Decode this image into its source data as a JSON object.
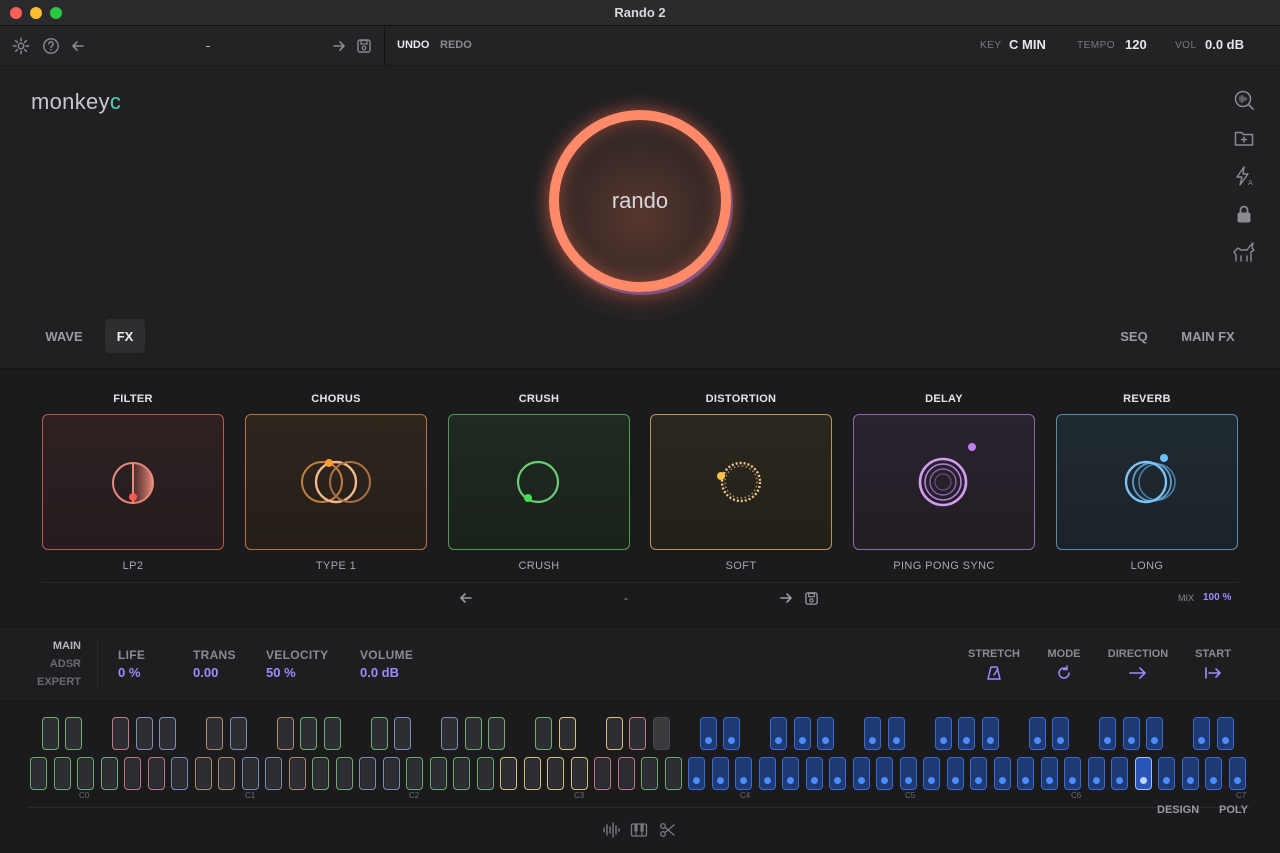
{
  "window": {
    "title": "Rando 2"
  },
  "toolbar": {
    "preset_name": "-",
    "undo_label": "UNDO",
    "redo_label": "REDO",
    "key_label": "KEY",
    "key_value": "C MIN",
    "tempo_label": "TEMPO",
    "tempo_value": "120",
    "vol_label": "VOL",
    "vol_value": "0.0 dB"
  },
  "logo": {
    "text_main": "monkey",
    "text_accent": "c"
  },
  "center_ring": {
    "label": "rando",
    "color": "#ff8a6a"
  },
  "sidebar_icons": [
    "search-sound-icon",
    "add-folder-icon",
    "auto-flash-icon",
    "lock-icon",
    "unicorn-icon"
  ],
  "tabs": {
    "left": [
      {
        "label": "WAVE",
        "active": false
      },
      {
        "label": "FX",
        "active": true
      }
    ],
    "right": [
      {
        "label": "SEQ"
      },
      {
        "label": "MAIN FX"
      }
    ]
  },
  "fx": {
    "modules": [
      {
        "title": "FILTER",
        "value": "LP2",
        "color": "#e8786a"
      },
      {
        "title": "CHORUS",
        "value": "TYPE 1",
        "color": "#e0955a"
      },
      {
        "title": "CRUSH",
        "value": "CRUSH",
        "color": "#5fbf6a"
      },
      {
        "title": "DISTORTION",
        "value": "SOFT",
        "color": "#d9b664"
      },
      {
        "title": "DELAY",
        "value": "PING PONG SYNC",
        "color": "#c08ae6"
      },
      {
        "title": "REVERB",
        "value": "LONG",
        "color": "#6ab8f0"
      }
    ],
    "preset_name": "-",
    "mix_label": "MIX",
    "mix_value": "100 %"
  },
  "params": {
    "submenu": [
      "MAIN",
      "ADSR",
      "EXPERT"
    ],
    "left": [
      {
        "label": "LIFE",
        "value": "0 %"
      },
      {
        "label": "TRANS",
        "value": "0.00"
      },
      {
        "label": "VELOCITY",
        "value": "50 %"
      },
      {
        "label": "VOLUME",
        "value": "0.0 dB"
      }
    ],
    "right": [
      {
        "label": "STRETCH",
        "icon": "metronome-icon"
      },
      {
        "label": "MODE",
        "icon": "loop-icon"
      },
      {
        "label": "DIRECTION",
        "icon": "arrow-right-icon"
      },
      {
        "label": "START",
        "icon": "start-arrow-icon"
      }
    ]
  },
  "keyboard": {
    "octave_labels": [
      "C0",
      "C1",
      "C2",
      "C3",
      "C4",
      "C5",
      "C6",
      "C7"
    ],
    "design_label": "DESIGN",
    "poly_label": "POLY"
  },
  "colors": {
    "accent": "#9d8cff",
    "key_blue": "#3e6ad6"
  }
}
